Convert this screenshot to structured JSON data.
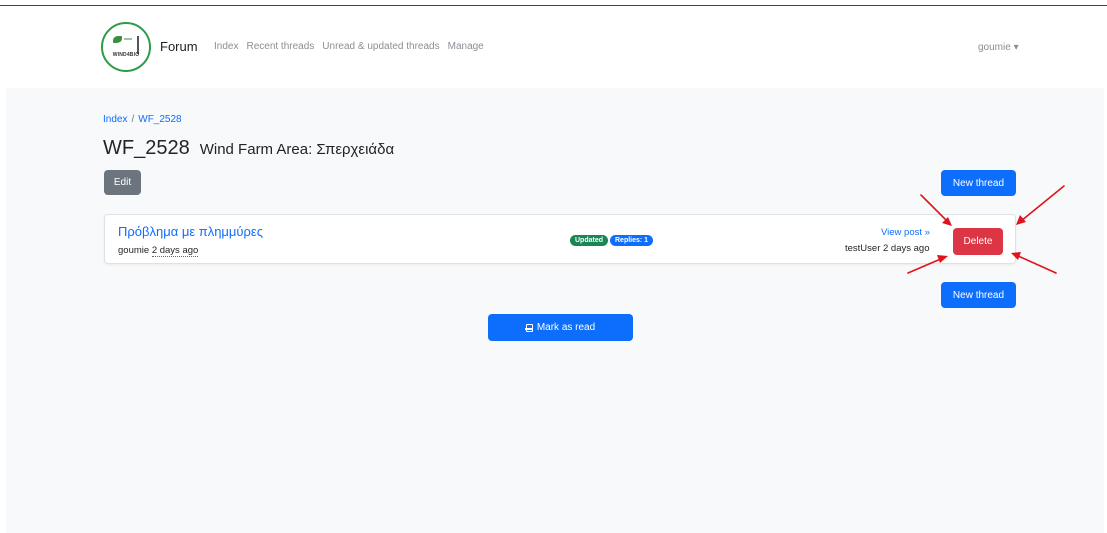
{
  "logo": {
    "text": "WIND4BIO"
  },
  "navbar": {
    "brand": "Forum",
    "links": [
      "Index",
      "Recent threads",
      "Unread & updated threads",
      "Manage"
    ],
    "user": "goumie ▾"
  },
  "breadcrumb": {
    "home": "Index",
    "separator": "/",
    "current": "WF_2528"
  },
  "page": {
    "title": "WF_2528",
    "subtitle": "Wind Farm Area: Σπερχειάδα"
  },
  "buttons": {
    "edit": "Edit",
    "new_thread_top": "New thread",
    "new_thread_bottom": "New thread",
    "mark_as_read": "Mark as read"
  },
  "thread": {
    "title": "Πρόβλημα με πλημμύρες",
    "author": "goumie",
    "created": "2 days ago",
    "badges": [
      "Updated",
      "Replies: 1"
    ],
    "view_post": "View post »",
    "last_post": "testUser 2 days ago",
    "delete_label": "Delete"
  },
  "colors": {
    "primary": "#0d6efd",
    "secondary": "#6c757d",
    "danger": "#dc3545",
    "success": "#198754",
    "annotation": "#e0141e"
  }
}
